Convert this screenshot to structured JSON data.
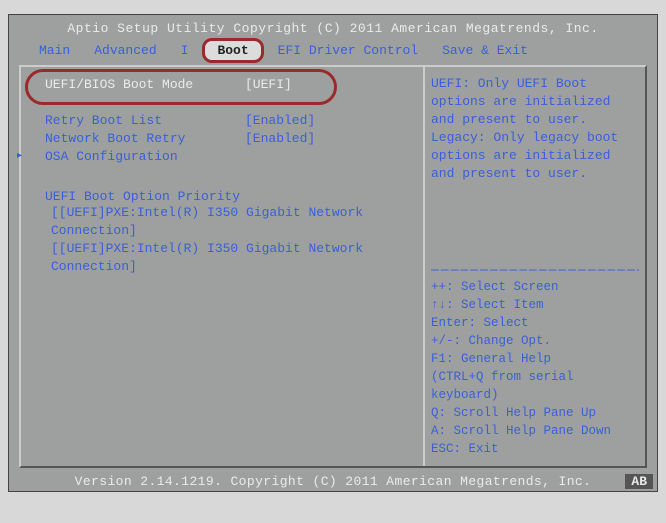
{
  "header": "Aptio Setup Utility   Copyright (C) 2011 American Megatrends, Inc.",
  "menu": {
    "items": [
      "Main",
      "Advanced",
      "I",
      "Boot",
      "EFI Driver Control",
      "Save & Exit"
    ],
    "active_index": 3
  },
  "boot": {
    "rows": [
      {
        "label": "UEFI/BIOS Boot Mode",
        "value": "[UEFI]",
        "selected": true
      },
      {
        "label": "",
        "value": ""
      },
      {
        "label": "Retry Boot List",
        "value": "[Enabled]"
      },
      {
        "label": "Network Boot Retry",
        "value": "[Enabled]"
      },
      {
        "label": "OSA Configuration",
        "value": "",
        "submenu": true
      }
    ],
    "priority_heading": "UEFI Boot Option Priority",
    "priority_items": [
      "[[UEFI]PXE:Intel(R) I350 Gigabit Network Connection]",
      "[[UEFI]PXE:Intel(R) I350 Gigabit Network Connection]"
    ]
  },
  "help": {
    "context": "UEFI: Only UEFI Boot options are initialized and present to user. Legacy: Only legacy boot options are initialized and present to user.",
    "keys": [
      "++: Select Screen",
      "↑↓: Select Item",
      "Enter: Select",
      "+/-: Change Opt.",
      "F1: General Help",
      " (CTRL+Q from serial",
      " keyboard)",
      "Q: Scroll Help Pane Up",
      "A: Scroll Help Pane Down",
      "ESC: Exit"
    ]
  },
  "footer": "Version 2.14.1219. Copyright (C) 2011 American Megatrends, Inc.",
  "badge": "AB"
}
